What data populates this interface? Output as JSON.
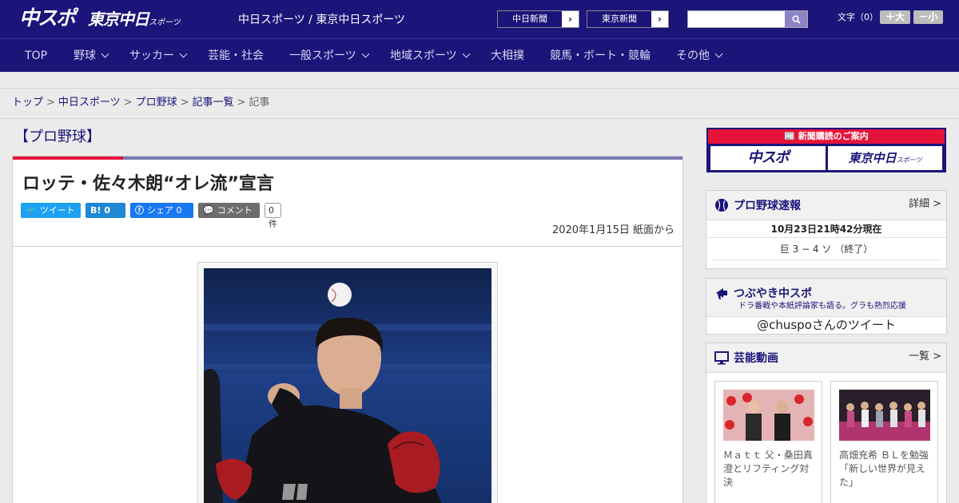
{
  "header": {
    "logo_chuspo": "中スポ",
    "logo_tokyo": "東京中日",
    "logo_tokyo_sub": "スポーツ",
    "site_name": "中日スポーツ / 東京中日スポーツ",
    "link_chunichi": "中日新聞",
    "link_tokyo": "東京新聞",
    "search_placeholder": "",
    "font_size_label": "文字（0）",
    "font_bigger": "＋大",
    "font_smaller": "－小"
  },
  "nav": {
    "items": [
      {
        "label": "TOP",
        "has_dropdown": false
      },
      {
        "label": "野球",
        "has_dropdown": true
      },
      {
        "label": "サッカー",
        "has_dropdown": true
      },
      {
        "label": "芸能・社会",
        "has_dropdown": false
      },
      {
        "label": "一般スポーツ",
        "has_dropdown": true
      },
      {
        "label": "地域スポーツ",
        "has_dropdown": true
      },
      {
        "label": "大相撲",
        "has_dropdown": false
      },
      {
        "label": "競馬・ボート・競輪",
        "has_dropdown": false
      },
      {
        "label": "その他",
        "has_dropdown": true
      }
    ]
  },
  "breadcrumb": {
    "items": [
      "トップ",
      "中日スポーツ",
      "プロ野球",
      "記事一覧"
    ],
    "current": "記事"
  },
  "article": {
    "category": "【プロ野球】",
    "headline": "ロッテ・佐々木朗“オレ流”宣言",
    "share": {
      "tweet": "ツイート",
      "hatena_icon": "B!",
      "hatena_count": "0",
      "facebook": "シェア",
      "facebook_count": "0",
      "comment": "コメント",
      "comment_count": "0件"
    },
    "date": "2020年1月15日 紙面から"
  },
  "sidebar": {
    "ad_title": "新聞購読のご案内",
    "ad_logo_1": "中スポ",
    "ad_logo_2": "東京中日",
    "ad_logo_2_sub": "スポーツ",
    "score": {
      "title": "プロ野球速報",
      "more": "詳細 >",
      "time": "10月23日21時42分現在",
      "game": "巨 3 − 4 ソ （終了）"
    },
    "tweets": {
      "title": "つぶやき中スポ",
      "subtitle": "ドラ番戦や本紙評論家も語る。グラも熱烈応援",
      "handle": "@chuspoさんのツイート"
    },
    "videos": {
      "title": "芸能動画",
      "more": "一覧 >",
      "items": [
        {
          "caption": "Ｍａｔｔ 父・桑田真澄とリフティング対決"
        },
        {
          "caption": "高畑充希 ＢＬを勉強「新しい世界が見えた」"
        }
      ]
    }
  },
  "colors": {
    "brand_navy": "#1b1479",
    "accent_red": "#e6143a",
    "twitter_blue": "#1da1f2",
    "facebook_blue": "#1877f2"
  }
}
